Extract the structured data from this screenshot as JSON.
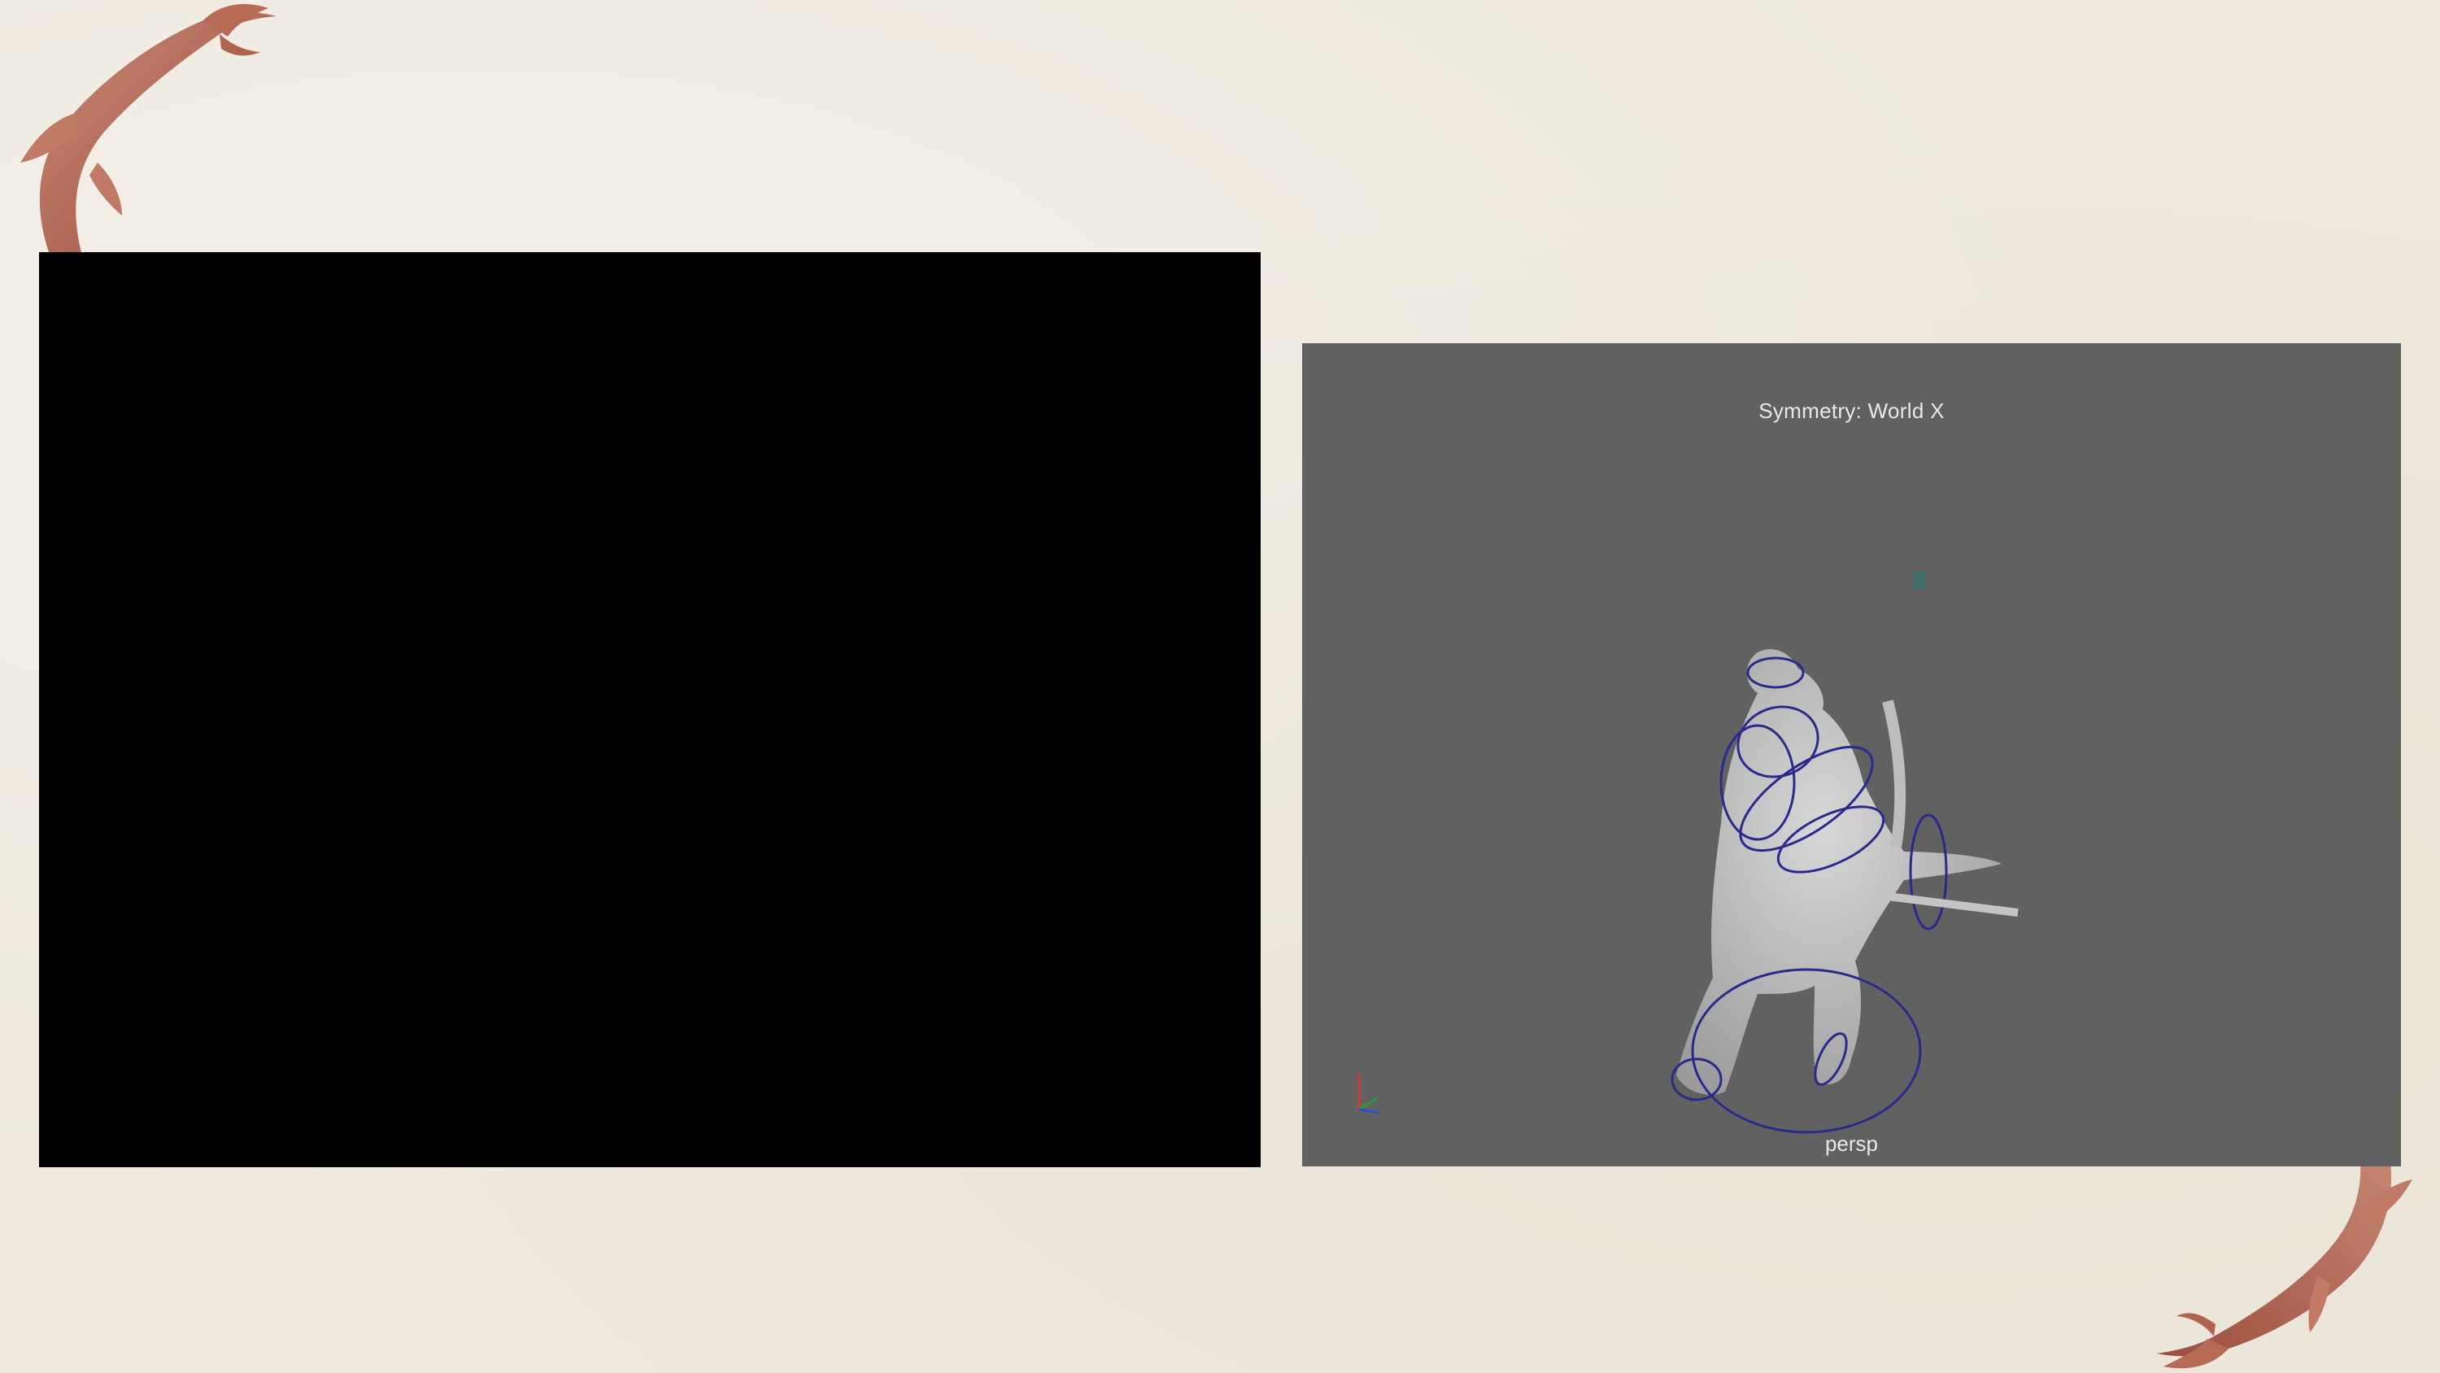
{
  "viewport": {
    "symmetry_label": "Symmetry: World X",
    "camera_label": "persp",
    "background_color": "#616161",
    "rig_color": "#2a2a8c"
  },
  "video_panel": {
    "color": "#000000"
  },
  "decor": {
    "fish_color": "#b8705c",
    "background": "#efe9de"
  }
}
